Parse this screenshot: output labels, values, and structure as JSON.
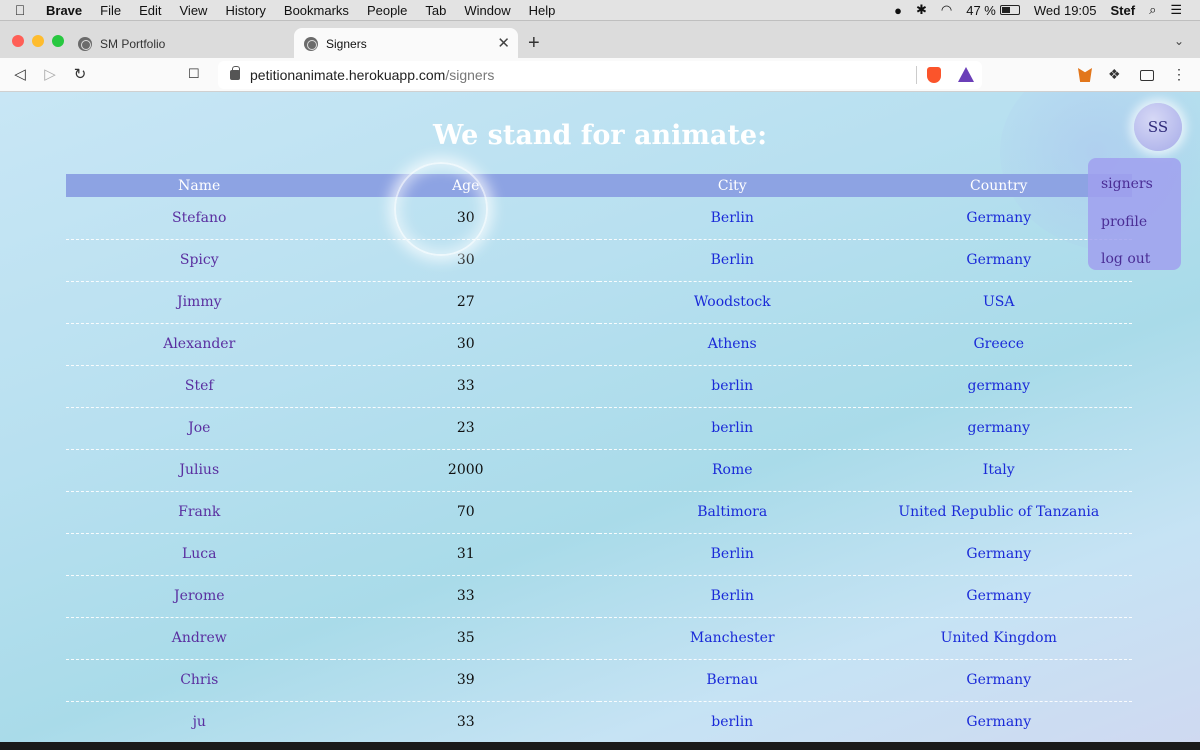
{
  "menubar": {
    "app": "Brave",
    "items": [
      "File",
      "Edit",
      "View",
      "History",
      "Bookmarks",
      "People",
      "Tab",
      "Window",
      "Help"
    ],
    "battery": "47 %",
    "clock": "Wed 19:05",
    "user": "Stef"
  },
  "browser": {
    "tabs": [
      {
        "title": "SM Portfolio"
      },
      {
        "title": "Signers"
      }
    ],
    "url_host": "petitionanimate.herokuapp.com",
    "url_path": "/signers"
  },
  "page": {
    "title": "We stand for animate:",
    "avatar_initials": "SS",
    "menu": [
      "signers",
      "profile",
      "log out"
    ],
    "table": {
      "headers": [
        "Name",
        "Age",
        "City",
        "Country"
      ],
      "rows": [
        [
          "Stefano",
          "30",
          "Berlin",
          "Germany"
        ],
        [
          "Spicy",
          "30",
          "Berlin",
          "Germany"
        ],
        [
          "Jimmy",
          "27",
          "Woodstock",
          "USA"
        ],
        [
          "Alexander",
          "30",
          "Athens",
          "Greece"
        ],
        [
          "Stef",
          "33",
          "berlin",
          "germany"
        ],
        [
          "Joe",
          "23",
          "berlin",
          "germany"
        ],
        [
          "Julius",
          "2000",
          "Rome",
          "Italy"
        ],
        [
          "Frank",
          "70",
          "Baltimora",
          "United Republic of Tanzania"
        ],
        [
          "Luca",
          "31",
          "Berlin",
          "Germany"
        ],
        [
          "Jerome",
          "33",
          "Berlin",
          "Germany"
        ],
        [
          "Andrew",
          "35",
          "Manchester",
          "United Kingdom"
        ],
        [
          "Chris",
          "39",
          "Bernau",
          "Germany"
        ],
        [
          "ju",
          "33",
          "berlin",
          "Germany"
        ]
      ]
    }
  }
}
